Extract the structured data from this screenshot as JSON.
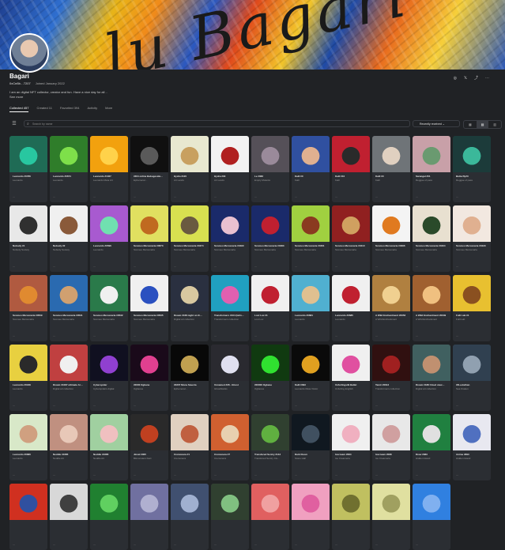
{
  "banner": {
    "script_text": "lu Bagari"
  },
  "profile": {
    "title": "Bagari",
    "address": "0xCe8b…7207",
    "joined": "Joined January 2022",
    "description": "I am an digital NFT collector, creator and fun. Have a nice day for all ..",
    "see_more": "See more"
  },
  "tabs": [
    {
      "label": "Collected 457",
      "active": true
    },
    {
      "label": "Created 11",
      "active": false
    },
    {
      "label": "Favorited 394",
      "active": false
    },
    {
      "label": "Activity",
      "active": false
    },
    {
      "label": "More",
      "active": false
    }
  ],
  "actions": {
    "website": "◎",
    "twitter": "𝕏",
    "share": "⤴",
    "more": "⋯"
  },
  "toolbar": {
    "filter_icon": "filter-icon",
    "search_placeholder": "Search by name",
    "sort_label": "Recently received",
    "views": [
      "▦",
      "▤",
      "▥"
    ]
  },
  "colors": {
    "background": "#202225",
    "card": "#2b2e33",
    "border": "#3b3e44"
  },
  "cards": [
    {
      "name": "Leonardo #0786",
      "collection": "Leonardo",
      "bg": "#1f6b55",
      "fg": "#28c7a0"
    },
    {
      "name": "Leonardo #0674",
      "collection": "Leonardo",
      "bg": "#2f7d2a",
      "fg": "#7ee04a"
    },
    {
      "name": "Leonardo #1027",
      "collection": "Leonardo Meta Art",
      "bg": "#f2a10e",
      "fg": "#ffd24a"
    },
    {
      "name": "#304 online Babugeside…",
      "collection": "Ephemeral…",
      "bg": "#101010",
      "fg": "#5a5a5a"
    },
    {
      "name": "Hydra #120",
      "collection": "Art Lands",
      "bg": "#e8e8d0",
      "fg": "#c8a060"
    },
    {
      "name": "Hydra #03",
      "collection": "Art Lands",
      "bg": "#f2f2f2",
      "fg": "#b02020"
    },
    {
      "name": "Le #082",
      "collection": "Empty Mutants",
      "bg": "#555058",
      "fg": "#9a8a9a"
    },
    {
      "name": "Kalil #0",
      "collection": "Kalil",
      "bg": "#3050a0",
      "fg": "#e0b090"
    },
    {
      "name": "Kalil #10",
      "collection": "Kalil",
      "bg": "#c02030",
      "fg": "#2a2a2a"
    },
    {
      "name": "Kalil #0",
      "collection": "Kalil",
      "bg": "#6f7478",
      "fg": "#e0d0c0"
    },
    {
      "name": "Sarangal #01",
      "collection": "Reggae of pass",
      "bg": "#c8a0a8",
      "fg": "#6a9a70"
    },
    {
      "name": "Butterfly#3",
      "collection": "Reggae of pass",
      "bg": "#1c3b3a",
      "fg": "#3bb89a"
    },
    {
      "name": "Nobody #1",
      "collection": "Nobody Society",
      "bg": "#e8e8e8",
      "fg": "#303030"
    },
    {
      "name": "Nobody #2",
      "collection": "Nobody Society",
      "bg": "#f0f0f0",
      "fg": "#8a5a3a"
    },
    {
      "name": "Leonardo #0596",
      "collection": "Leonardo",
      "bg": "#a85ad0",
      "fg": "#70e0b0"
    },
    {
      "name": "Scomeo Mercenaria #0673",
      "collection": "Scomeo Mercenaria",
      "bg": "#e0e060",
      "fg": "#c06a20"
    },
    {
      "name": "Scomeo Mercenaria #0474",
      "collection": "Scomeo Mercenaria",
      "bg": "#d8e050",
      "fg": "#6a5a40"
    },
    {
      "name": "Scomeo Mercenaria #0490",
      "collection": "Scomeo Mercenaria",
      "bg": "#1a2a6a",
      "fg": "#e8c0d0"
    },
    {
      "name": "Scomeo Mercenaria #0483",
      "collection": "Scomeo Mercenaria",
      "bg": "#1a2a6a",
      "fg": "#c02030"
    },
    {
      "name": "Scomeo Mercenaria #0461",
      "collection": "Scomeo Mercenaria",
      "bg": "#a0d040",
      "fg": "#8a3a20"
    },
    {
      "name": "Scomeo Mercenaria #0410",
      "collection": "Scomeo Mercenaria",
      "bg": "#902020",
      "fg": "#d0a060"
    },
    {
      "name": "Scomeo Mercenaria #0396",
      "collection": "Scomeo Mercenaria",
      "bg": "#f4f4f4",
      "fg": "#e07a20"
    },
    {
      "name": "Scomeo Mercenaria #0404",
      "collection": "Scomeo Mercenaria",
      "bg": "#e8e0d0",
      "fg": "#2a4a2a"
    },
    {
      "name": "Scomeo Mercenaria #0429",
      "collection": "Scomeo Mercenaria",
      "bg": "#f2e8e0",
      "fg": "#e0b090"
    },
    {
      "name": "Scomeo Mercenaria #0509",
      "collection": "Scomeo Mercenaria",
      "bg": "#b05a40",
      "fg": "#e08a30"
    },
    {
      "name": "Scomeo Mercenaria #0531",
      "collection": "Scomeo Mercenaria",
      "bg": "#2a6ab0",
      "fg": "#d0a070"
    },
    {
      "name": "Scomeo Mercenaria #0532",
      "collection": "Scomeo Mercenaria",
      "bg": "#2a7a4a",
      "fg": "#f0f0f0"
    },
    {
      "name": "Scomeo Mercenaria #0535",
      "collection": "Scomeo Mercenaria",
      "bg": "#f0f0f0",
      "fg": "#2a50c0"
    },
    {
      "name": "Dream #168 night on th…",
      "collection": "Digital art collection",
      "bg": "#2a3040",
      "fg": "#d8c8a0"
    },
    {
      "name": "Transformers #104 (latin…",
      "collection": "Transformers collection",
      "bg": "#20a0c0",
      "fg": "#e060b0"
    },
    {
      "name": "Lost Lux #1",
      "collection": "Lost Lux",
      "bg": "#f0f0f0",
      "fg": "#c02030"
    },
    {
      "name": "Leonardo #0684",
      "collection": "Leonardo",
      "bg": "#50b0d0",
      "fg": "#e0c090"
    },
    {
      "name": "Leonardo #0685",
      "collection": "Leonardo",
      "bg": "#f0f0f0",
      "fg": "#c02030"
    },
    {
      "name": "A Wild Enchantment #0053",
      "collection": "A Wild Enchantment",
      "bg": "#b08040",
      "fg": "#f0d090"
    },
    {
      "name": "A Wild Enchantment #0049",
      "collection": "A Wild Enchantment",
      "bg": "#a06030",
      "fg": "#f0c080"
    },
    {
      "name": "Fulli Lab #1",
      "collection": "Fulli Lab",
      "bg": "#e8c030",
      "fg": "#8a5020"
    },
    {
      "name": "Leonardo #0189",
      "collection": "Leonardo",
      "bg": "#e8d040",
      "fg": "#2a2a2a"
    },
    {
      "name": "Dream #1087 ultimate Ar…",
      "collection": "Digital art collection",
      "bg": "#c04040",
      "fg": "#f0f0f0"
    },
    {
      "name": "Cyberspider",
      "collection": "Cyberspiders digital",
      "bg": "#101020",
      "fg": "#9040d0"
    },
    {
      "name": "#0000 Ogbane",
      "collection": "Ogbanes",
      "bg": "#1a0a1a",
      "fg": "#e04090"
    },
    {
      "name": "#0207 Mona Saveria",
      "collection": "Ephemeral…",
      "bg": "#080808",
      "fg": "#c0a050"
    },
    {
      "name": "Unnamed #28 - Ghost",
      "collection": "Ghostblanks",
      "bg": "#2a2a30",
      "fg": "#e0e0f0"
    },
    {
      "name": "#00000 Ogbane",
      "collection": "Ogbanes",
      "bg": "#103a10",
      "fg": "#30e030"
    },
    {
      "name": "Kalil #093",
      "collection": "Leonardo Meta Visitor",
      "bg": "#0a0a0a",
      "fg": "#e0a020"
    },
    {
      "name": "Unfurlingsilk Ballet",
      "collection": "Unfurling English",
      "bg": "#f0f0f0",
      "fg": "#e050a0"
    },
    {
      "name": "Tamir #0612",
      "collection": "Transformers collection",
      "bg": "#301010",
      "fg": "#a02020"
    },
    {
      "name": "Dream #188 Cloud view…",
      "collection": "Digital art collection",
      "bg": "#406060",
      "fg": "#c09070"
    },
    {
      "name": "#0Leviathan",
      "collection": "Sea Kraken",
      "bg": "#304050",
      "fg": "#90a0b0"
    },
    {
      "name": "Leonardo #0680",
      "collection": "Leonardo",
      "bg": "#d8e8c8",
      "fg": "#d0a080"
    },
    {
      "name": "Noddle #1685",
      "collection": "Noddle Art",
      "bg": "#c09080",
      "fg": "#e8c8b8"
    },
    {
      "name": "Noddle #1685",
      "collection": "Noddle Art",
      "bg": "#a0d0a0",
      "fg": "#f0c0c0"
    },
    {
      "name": "Jinzel #005",
      "collection": "Bitmonsters Fact",
      "bg": "#2a2a2a",
      "fg": "#c04020"
    },
    {
      "name": "Cremonera #1",
      "collection": "Cremonera",
      "bg": "#e0d0c0",
      "fg": "#c06040"
    },
    {
      "name": "Cremonera #7",
      "collection": "Cremonera",
      "bg": "#d06030",
      "fg": "#e8d0b0"
    },
    {
      "name": "Transfered Sentry #143",
      "collection": "Transfered Sentry Clu…",
      "bg": "#304030",
      "fg": "#60b040"
    },
    {
      "name": "Dark Room",
      "collection": "Stone Hall",
      "bg": "#101820",
      "fg": "#405060"
    },
    {
      "name": "Icecream #084",
      "collection": "Ice Creameria",
      "bg": "#f0f0f0",
      "fg": "#f0b0c0"
    },
    {
      "name": "Icecream #088",
      "collection": "Ice Creameria",
      "bg": "#e8e8e8",
      "fg": "#d0a0a0"
    },
    {
      "name": "Drew #683",
      "collection": "Hidden Island",
      "bg": "#208040",
      "fg": "#e0e0e0"
    },
    {
      "name": "Anime #893",
      "collection": "Hidden Island",
      "bg": "#e8e8f0",
      "fg": "#5070c0"
    },
    {
      "name": "",
      "collection": "",
      "bg": "#d03020",
      "fg": "#3050a0"
    },
    {
      "name": "",
      "collection": "",
      "bg": "#d8d8d8",
      "fg": "#404040"
    },
    {
      "name": "",
      "collection": "",
      "bg": "#208030",
      "fg": "#60d060"
    },
    {
      "name": "",
      "collection": "",
      "bg": "#7070a0",
      "fg": "#b0b0d0"
    },
    {
      "name": "",
      "collection": "",
      "bg": "#405070",
      "fg": "#a0b0d0"
    },
    {
      "name": "",
      "collection": "",
      "bg": "#304030",
      "fg": "#80c080"
    },
    {
      "name": "",
      "collection": "",
      "bg": "#e06060",
      "fg": "#f0a0a0"
    },
    {
      "name": "",
      "collection": "",
      "bg": "#f0a0c0",
      "fg": "#e060a0"
    },
    {
      "name": "",
      "collection": "",
      "bg": "#c0c060",
      "fg": "#707030"
    },
    {
      "name": "",
      "collection": "",
      "bg": "#e0e0a0",
      "fg": "#a0a060"
    },
    {
      "name": "",
      "collection": "",
      "bg": "#3080e0",
      "fg": "#80b0f0"
    }
  ]
}
